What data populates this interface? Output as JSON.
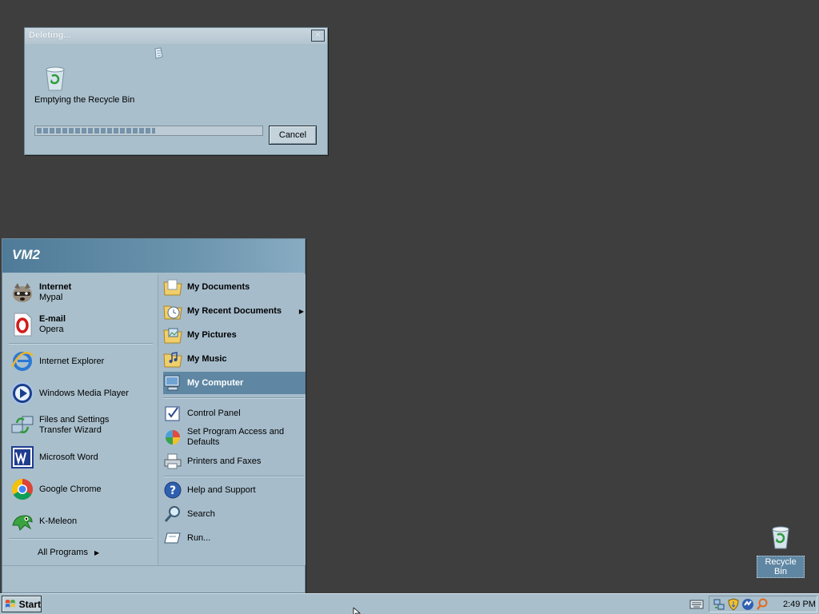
{
  "dialog": {
    "title": "Deleting...",
    "close_glyph": "✕",
    "message": "Emptying the Recycle Bin",
    "progress_percent": 53,
    "cancel_label": "Cancel",
    "icons": [
      "paper-animation-icon",
      "recycle-bin-icon"
    ]
  },
  "start_menu": {
    "user_name": "VM2",
    "pinned": [
      {
        "title": "Internet",
        "subtitle": "Mypal",
        "icon": "mypal-raccoon-icon"
      },
      {
        "title": "E-mail",
        "subtitle": "Opera",
        "icon": "opera-icon"
      }
    ],
    "recent": [
      {
        "label": "Internet Explorer",
        "icon": "internet-explorer-icon"
      },
      {
        "label": "Windows Media Player",
        "icon": "media-player-icon"
      },
      {
        "label": "Files and Settings Transfer Wizard",
        "icon": "transfer-wizard-icon"
      },
      {
        "label": "Microsoft Word",
        "icon": "word-icon"
      },
      {
        "label": "Google Chrome",
        "icon": "chrome-icon"
      },
      {
        "label": "K-Meleon",
        "icon": "k-meleon-icon"
      }
    ],
    "all_programs_label": "All Programs",
    "all_programs_arrow": "▶",
    "right": {
      "my_documents": "My Documents",
      "my_recent_documents": "My Recent Documents",
      "submenu_arrow": "▶",
      "my_pictures": "My Pictures",
      "my_music": "My Music",
      "my_computer": "My Computer",
      "control_panel": "Control Panel",
      "set_program_access": "Set Program Access and Defaults",
      "printers_and_faxes": "Printers and Faxes",
      "help_and_support": "Help and Support",
      "search": "Search",
      "run": "Run..."
    },
    "selected_item": "My Computer"
  },
  "desktop": {
    "recycle_bin_label": "Recycle Bin"
  },
  "taskbar": {
    "start_label": "Start",
    "clock": "2:49 PM",
    "tray_icons": [
      "network-icon",
      "security-shield-icon",
      "update-icon",
      "search-tray-icon"
    ]
  },
  "colors": {
    "desktop": "#3e3e3e",
    "window_face": "#a9bfcc",
    "selection": "#5f87a3",
    "header_gradient_start": "#4f7b98"
  }
}
